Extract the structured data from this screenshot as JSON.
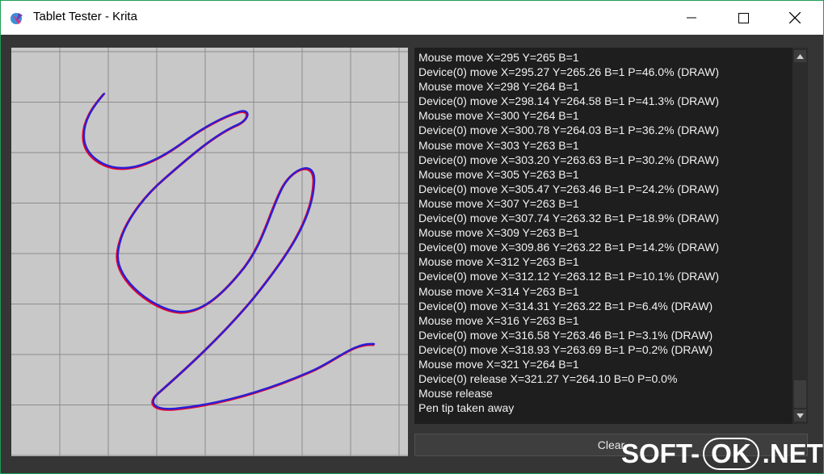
{
  "window": {
    "title": "Tablet Tester - Krita"
  },
  "titlebar_buttons": {
    "minimize_icon": "minimize-icon",
    "maximize_icon": "maximize-icon",
    "close_icon": "close-icon"
  },
  "log": {
    "lines": [
      "Mouse move X=295 Y=265 B=1",
      "Device(0) move X=295.27 Y=265.26 B=1 P=46.0% (DRAW)",
      "Mouse move X=298 Y=264 B=1",
      "Device(0) move X=298.14 Y=264.58 B=1 P=41.3% (DRAW)",
      "Mouse move X=300 Y=264 B=1",
      "Device(0) move X=300.78 Y=264.03 B=1 P=36.2% (DRAW)",
      "Mouse move X=303 Y=263 B=1",
      "Device(0) move X=303.20 Y=263.63 B=1 P=30.2% (DRAW)",
      "Mouse move X=305 Y=263 B=1",
      "Device(0) move X=305.47 Y=263.46 B=1 P=24.2% (DRAW)",
      "Mouse move X=307 Y=263 B=1",
      "Device(0) move X=307.74 Y=263.32 B=1 P=18.9% (DRAW)",
      "Mouse move X=309 Y=263 B=1",
      "Device(0) move X=309.86 Y=263.22 B=1 P=14.2% (DRAW)",
      "Mouse move X=312 Y=263 B=1",
      "Device(0) move X=312.12 Y=263.12 B=1 P=10.1% (DRAW)",
      "Mouse move X=314 Y=263 B=1",
      "Device(0) move X=314.31 Y=263.22 B=1 P=6.4% (DRAW)",
      "Mouse move X=316 Y=263 B=1",
      "Device(0) move X=316.58 Y=263.46 B=1 P=3.1% (DRAW)",
      "Device(0) move X=318.93 Y=263.69 B=1 P=0.2% (DRAW)",
      "Mouse move X=321 Y=264 B=1",
      "Device(0) release X=321.27 Y=264.10 B=0 P=0.0%",
      "Mouse release",
      "Pen tip taken away"
    ]
  },
  "clear_button": {
    "label": "Clear"
  },
  "watermark": {
    "part1": "SOFT-",
    "part2": "OK",
    "part3": ".NET"
  },
  "colors": {
    "stroke_mouse": "#e8002a",
    "stroke_pen": "#2a1fd6",
    "canvas_bg": "#c8c8c8",
    "grid": "#8c8c8c",
    "log_bg": "#1e1e1e"
  }
}
